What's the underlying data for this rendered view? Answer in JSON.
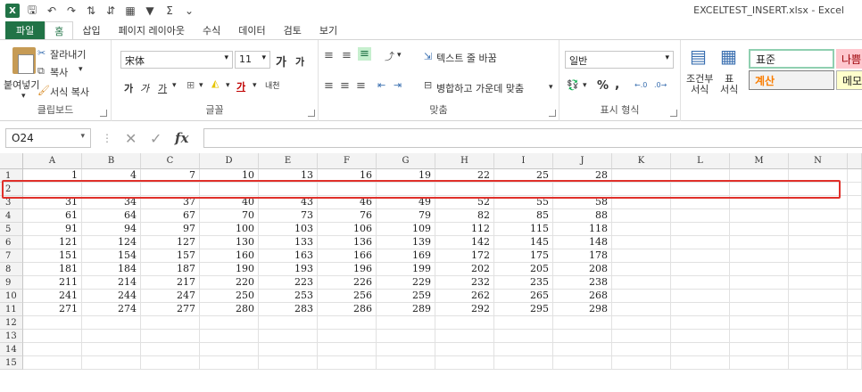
{
  "window": {
    "title": "EXCELTEST_INSERT.xlsx - Excel"
  },
  "quick_access": [
    {
      "name": "save-icon",
      "glyph": "🖫"
    },
    {
      "name": "undo-icon",
      "glyph": "↶"
    },
    {
      "name": "redo-icon",
      "glyph": "↷"
    },
    {
      "name": "sort-asc-icon",
      "glyph": "⇅"
    },
    {
      "name": "sort-desc-icon",
      "glyph": "⇵"
    },
    {
      "name": "form-icon",
      "glyph": "▦"
    },
    {
      "name": "filter-icon",
      "glyph": "▼"
    },
    {
      "name": "sum-icon",
      "glyph": "Σ"
    },
    {
      "name": "customize-icon",
      "glyph": "⌄"
    }
  ],
  "tabs": [
    {
      "label": "파일",
      "kind": "file"
    },
    {
      "label": "홈",
      "kind": "active"
    },
    {
      "label": "삽입",
      "kind": ""
    },
    {
      "label": "페이지 레이아웃",
      "kind": ""
    },
    {
      "label": "수식",
      "kind": ""
    },
    {
      "label": "데이터",
      "kind": ""
    },
    {
      "label": "검토",
      "kind": ""
    },
    {
      "label": "보기",
      "kind": ""
    }
  ],
  "ribbon": {
    "clipboard": {
      "paste": "붙여넣기",
      "cut": "잘라내기",
      "copy": "복사",
      "format_painter": "서식 복사",
      "label": "클립보드"
    },
    "font": {
      "family": "宋体",
      "size": "11",
      "grow": "가",
      "shrink": "가",
      "bold": "가",
      "italic": "가",
      "underline": "가",
      "font_color": "가",
      "phonetic": "내천",
      "label": "글꼴"
    },
    "alignment": {
      "wrap_text": "텍스트 줄 바꿈",
      "merge_center": "병합하고 가운데 맞춤",
      "label": "맞춤"
    },
    "number": {
      "format": "일반",
      "percent": "%",
      "comma": ",",
      "label": "표시 형식"
    },
    "styles": {
      "conditional": "조건부\n서식",
      "table": "표\n서식",
      "normal": "표준",
      "bad": "나쁨",
      "calculation": "계산",
      "note": "메모"
    }
  },
  "formula_bar": {
    "name_box": "O24",
    "cancel": "✕",
    "enter": "✓",
    "fx": "fx",
    "value": ""
  },
  "sheet": {
    "columns": [
      "A",
      "B",
      "C",
      "D",
      "E",
      "F",
      "G",
      "H",
      "I",
      "J",
      "K",
      "L",
      "M",
      "N"
    ],
    "rows": [
      [
        "1",
        "4",
        "7",
        "10",
        "13",
        "16",
        "19",
        "22",
        "25",
        "28"
      ],
      [],
      [
        "31",
        "34",
        "37",
        "40",
        "43",
        "46",
        "49",
        "52",
        "55",
        "58"
      ],
      [
        "61",
        "64",
        "67",
        "70",
        "73",
        "76",
        "79",
        "82",
        "85",
        "88"
      ],
      [
        "91",
        "94",
        "97",
        "100",
        "103",
        "106",
        "109",
        "112",
        "115",
        "118"
      ],
      [
        "121",
        "124",
        "127",
        "130",
        "133",
        "136",
        "139",
        "142",
        "145",
        "148"
      ],
      [
        "151",
        "154",
        "157",
        "160",
        "163",
        "166",
        "169",
        "172",
        "175",
        "178"
      ],
      [
        "181",
        "184",
        "187",
        "190",
        "193",
        "196",
        "199",
        "202",
        "205",
        "208"
      ],
      [
        "211",
        "214",
        "217",
        "220",
        "223",
        "226",
        "229",
        "232",
        "235",
        "238"
      ],
      [
        "241",
        "244",
        "247",
        "250",
        "253",
        "256",
        "259",
        "262",
        "265",
        "268"
      ],
      [
        "271",
        "274",
        "277",
        "280",
        "283",
        "286",
        "289",
        "292",
        "295",
        "298"
      ],
      [],
      [],
      [],
      []
    ],
    "highlighted_row": 2,
    "highlight_color": "#e0302a"
  },
  "colors": {
    "excel_green": "#217346"
  }
}
